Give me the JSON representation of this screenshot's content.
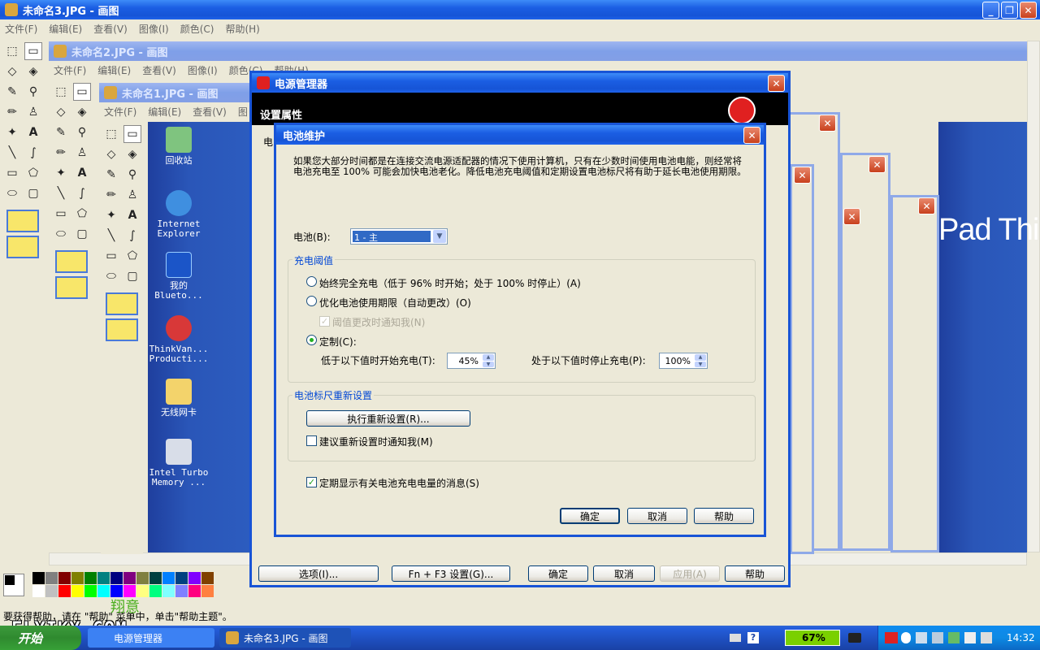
{
  "paint3": {
    "title": "未命名3.JPG - 画图",
    "menu": [
      "文件(F)",
      "编辑(E)",
      "查看(V)",
      "图像(I)",
      "颜色(C)",
      "帮助(H)"
    ],
    "status": "要获得帮助，请在 \"帮助\" 菜单中，单击\"帮助主题\"。"
  },
  "paint2": {
    "title": "未命名2.JPG - 画图",
    "menu": [
      "文件(F)",
      "编辑(E)",
      "查看(V)",
      "图像(I)",
      "颜色(C)",
      "帮助(H)"
    ]
  },
  "paint1": {
    "title": "未命名1.JPG - 画图",
    "menu": [
      "文件(F)",
      "编辑(E)",
      "查看(V)",
      "图"
    ]
  },
  "desktop_icons": [
    {
      "label": "回收站"
    },
    {
      "label": "Internet Explorer"
    },
    {
      "label": "我的 Blueto..."
    },
    {
      "label": "ThinkVan... Producti..."
    },
    {
      "label": "无线网卡"
    },
    {
      "label": "Intel Turbo Memory ..."
    }
  ],
  "power_manager": {
    "title": "电源管理器",
    "header": "设置属性",
    "tab_fragment": "电",
    "buttons": {
      "options": "选项(I)...",
      "fn_f3": "Fn + F3 设置(G)...",
      "ok": "确定",
      "cancel": "取消",
      "apply": "应用(A)",
      "help": "帮助"
    }
  },
  "battery_dialog": {
    "title": "电池维护",
    "description": "如果您大部分时间都是在连接交流电源适配器的情况下使用计算机，只有在少数时间使用电池电能，则经常将电池充电至 100% 可能会加快电池老化。降低电池充电阈值和定期设置电池标尺将有助于延长电池使用期限。",
    "battery_label": "电池(B):",
    "battery_value": "1 - 主",
    "threshold_group": "充电阈值",
    "options": {
      "always_full": "始终完全充电（低于 96% 时开始；处于 100% 时停止）(A)",
      "optimize": "优化电池使用期限（自动更改）(O)",
      "notify_change": "阈值更改时通知我(N)",
      "custom": "定制(C):"
    },
    "selected_option": "custom",
    "start_label": "低于以下值时开始充电(T):",
    "start_value": "45%",
    "stop_label": "处于以下值时停止充电(P):",
    "stop_value": "100%",
    "gauge_group": "电池标尺重新设置",
    "reset_button": "执行重新设置(R)...",
    "suggest_notify": "建议重新设置时通知我(M)",
    "periodic_msg": "定期显示有关电池充电电量的消息(S)",
    "ok": "确定",
    "cancel": "取消",
    "help": "帮助"
  },
  "background_text": {
    "brand_fragment": "Pad  Thin"
  },
  "watermark": {
    "text": "FLYIKY.COM",
    "cn": "翔意"
  },
  "taskbar": {
    "start": "开始",
    "task1": "电源管理器",
    "task2": "未命名3.JPG - 画图",
    "battery": "67%",
    "clock": "14:32"
  }
}
